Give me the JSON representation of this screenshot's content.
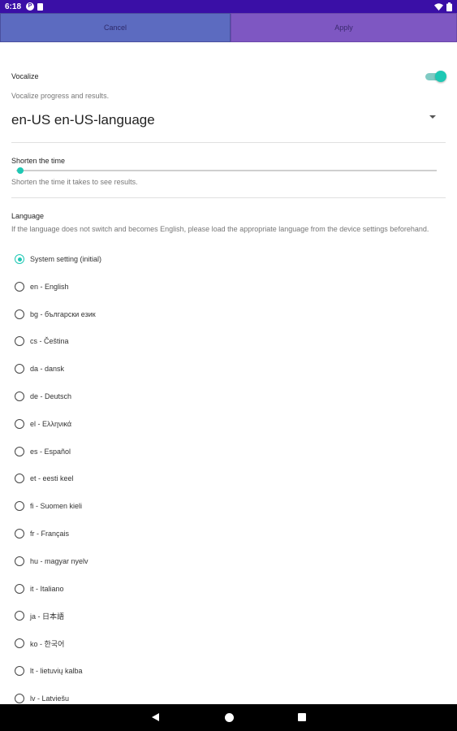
{
  "status_bar": {
    "time": "6:18",
    "icons": [
      "notification-p-icon",
      "sd-card-icon",
      "wifi-icon",
      "battery-icon"
    ]
  },
  "buttons": {
    "cancel": "Cancel",
    "apply": "Apply"
  },
  "vocalize": {
    "title": "Vocalize",
    "description": "Vocalize progress and results.",
    "enabled": true
  },
  "tts_engine": {
    "selected": "en-US en-US-language"
  },
  "shorten": {
    "title": "Shorten the time",
    "description": "Shorten the time it takes to see results.",
    "value": 0
  },
  "language": {
    "title": "Language",
    "description": "If the language does not switch and becomes English, please load the appropriate language from the device settings beforehand.",
    "options": [
      {
        "label": "System setting (initial)",
        "checked": true
      },
      {
        "label": "en - English",
        "checked": false
      },
      {
        "label": "bg - български език",
        "checked": false
      },
      {
        "label": "cs - Čeština",
        "checked": false
      },
      {
        "label": "da - dansk",
        "checked": false
      },
      {
        "label": "de - Deutsch",
        "checked": false
      },
      {
        "label": "el - Ελληνικά",
        "checked": false
      },
      {
        "label": "es - Español",
        "checked": false
      },
      {
        "label": "et - eesti keel",
        "checked": false
      },
      {
        "label": "fi - Suomen kieli",
        "checked": false
      },
      {
        "label": "fr - Français",
        "checked": false
      },
      {
        "label": "hu - magyar nyelv",
        "checked": false
      },
      {
        "label": "it - Italiano",
        "checked": false
      },
      {
        "label": "ja - 日本語",
        "checked": false
      },
      {
        "label": "ko - 한국어",
        "checked": false
      },
      {
        "label": "lt - lietuvių kalba",
        "checked": false
      },
      {
        "label": "lv - Latviešu",
        "checked": false
      }
    ]
  },
  "colors": {
    "status_bar": "#3a0fa6",
    "cancel_button": "#5c6bc0",
    "apply_button": "#7e57c2",
    "accent": "#1ec8b4"
  }
}
